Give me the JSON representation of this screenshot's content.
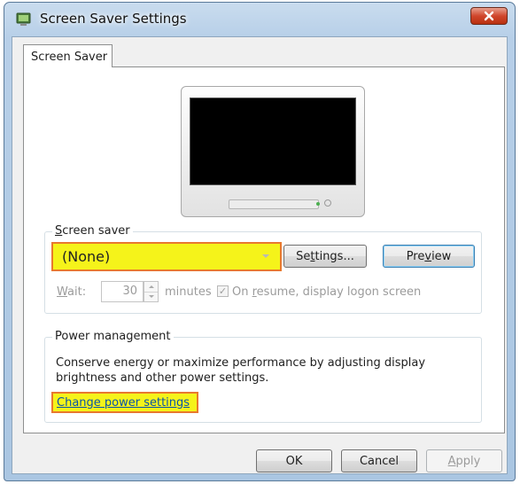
{
  "window": {
    "title": "Screen Saver Settings"
  },
  "tabs": [
    {
      "label": "Screen Saver"
    }
  ],
  "screen_saver": {
    "group_label_pre": "",
    "group_label_acc": "S",
    "group_label_post": "creen saver",
    "selected": "(None)",
    "settings_pre": "Se",
    "settings_acc": "t",
    "settings_post": "tings...",
    "preview_pre": "Pre",
    "preview_acc": "v",
    "preview_post": "iew",
    "wait_acc": "W",
    "wait_post": "ait:",
    "wait_value": "30",
    "minutes_label": "minutes",
    "resume_checked": true,
    "resume_pre": "On ",
    "resume_acc": "r",
    "resume_post": "esume, display logon screen"
  },
  "power": {
    "group_label": "Power management",
    "description": "Conserve energy or maximize performance by adjusting display brightness and other power settings.",
    "link": "Change power settings"
  },
  "footer": {
    "ok": "OK",
    "cancel": "Cancel",
    "apply_acc": "A",
    "apply_post": "pply"
  },
  "colors": {
    "highlight": "#f5f31a",
    "highlight_border": "#e8792e",
    "link": "#0b55a6"
  }
}
